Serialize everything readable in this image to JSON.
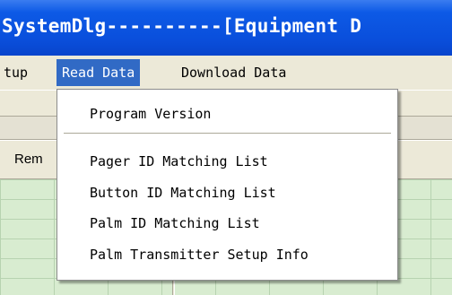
{
  "window": {
    "title": "SystemDlg----------[Equipment D"
  },
  "menubar": {
    "items": [
      {
        "label": "tup"
      },
      {
        "label": "Read Data"
      },
      {
        "label": "Download Data"
      }
    ]
  },
  "grid": {
    "header_label": "Rem"
  },
  "dropdown": {
    "items": [
      {
        "label": "Program Version"
      },
      {
        "label": "Pager ID Matching List"
      },
      {
        "label": "Button ID Matching List"
      },
      {
        "label": "Palm ID Matching List"
      },
      {
        "label": "Palm Transmitter Setup Info"
      }
    ]
  },
  "colors": {
    "titlebar": "#0a4fdc",
    "menu_highlight": "#316ac5",
    "grid_background": "#d8ecd0"
  }
}
